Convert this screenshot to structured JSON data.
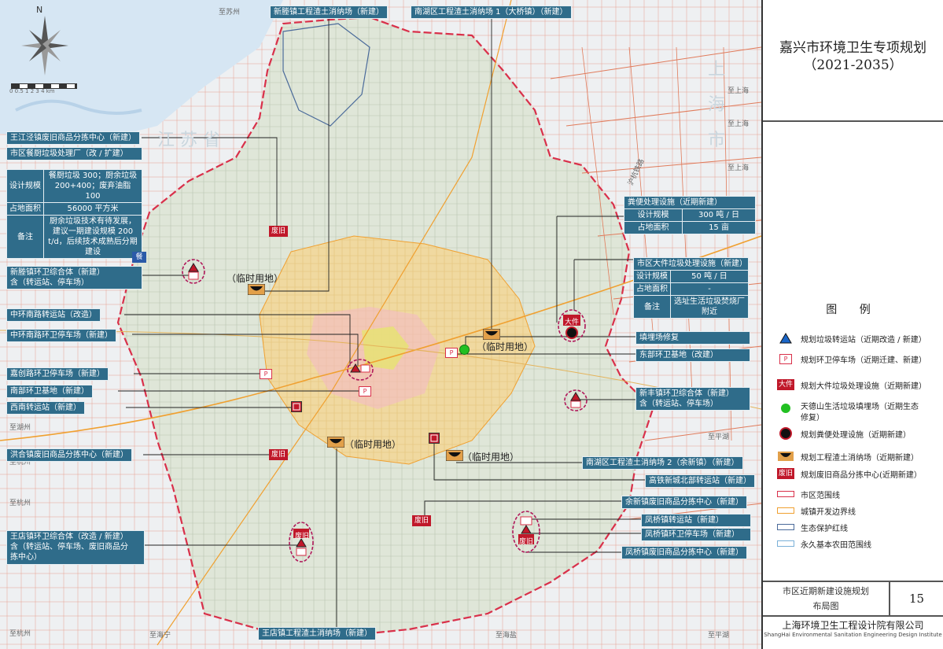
{
  "sheet": {
    "title_line1": "嘉兴市环境卫生专项规划",
    "title_line2": "（2021-2035）",
    "drawing_name_line1": "市区近期新建设施规划",
    "drawing_name_line2": "布局图",
    "sheet_number": "15",
    "institute_cn": "上海环境卫生工程设计院有限公司",
    "institute_en": "ShangHai Environmental Sanitation Engineering Design Institute"
  },
  "legend": {
    "title": "图 例",
    "items": [
      {
        "icon": "transfer-station-triangle",
        "label": "规划垃圾转运站（近期改造 / 新建）"
      },
      {
        "icon": "parking-p",
        "label": "规划环卫停车场（近期迁建、新建）"
      },
      {
        "icon": "bulky-waste-box",
        "icon_text": "大件",
        "label": "规划大件垃圾处理设施（近期新建）"
      },
      {
        "icon": "landfill-green-dot",
        "label": "天德山生活垃圾填埋场（近期生态",
        "label2": "修复）"
      },
      {
        "icon": "fecal-facility-dot",
        "label": "规划粪便处理设施（近期新建）"
      },
      {
        "icon": "construction-waste-bowl",
        "label": "规划工程渣土消纳场（近期新建）"
      },
      {
        "icon": "recycling-center-box",
        "icon_text": "废旧",
        "label": "规划废旧商品分拣中心(近期新建）"
      },
      {
        "icon": "city-boundary-line",
        "label": "市区范围线",
        "color": "#d9304a"
      },
      {
        "icon": "urban-boundary-line",
        "label": "城镇开发边界线",
        "color": "#f0a030"
      },
      {
        "icon": "ecological-redline",
        "label": "生态保护红线",
        "color": "#4a6a9a"
      },
      {
        "icon": "farmland-line",
        "label": "永久基本农田范围线",
        "color": "#7ab0d8"
      }
    ]
  },
  "map": {
    "scale_label": "0 0.5 1   2   3   4 km",
    "north_label": "N",
    "big_labels": [
      "江 苏 省",
      "上",
      "海",
      "市"
    ],
    "places": [
      "至苏州",
      "至上海",
      "至上海",
      "至上海",
      "至湖州",
      "至杭州",
      "至杭州",
      "至杭州",
      "至平湖",
      "至海盐",
      "至海宁",
      "至平湖",
      "沪杭铁路"
    ],
    "temp_land": "（临时用地）",
    "callouts": {
      "xinsheng_waste": "新塍镇工程渣土消纳场（新建）",
      "nanhu_waste1": "南湖区工程渣土消纳场 1（大桥镇）（新建）",
      "wangjiangjing_recycle": "王江泾镇废旧商品分拣中心（新建）",
      "kitchen_title": "市区餐厨垃圾处理厂（改 / 扩建）",
      "xinsheng_complex_1": "新塍镇环卫综合体（新建）",
      "xinsheng_complex_2": "含（转运站、停车场）",
      "zhonghuan_transfer": "中环南路转运站（改造）",
      "zhonghuan_parking": "中环南路环卫停车场（新建）",
      "jiachuang_parking": "嘉创路环卫停车场（新建）",
      "nanbu_base": "南部环卫基地（新建）",
      "xinan_transfer": "西南转运站（新建）",
      "honghe_recycle": "洪合镇废旧商品分拣中心（新建）",
      "wangdian_complex_1": "王店镇环卫综合体（改造 / 新建）",
      "wangdian_complex_2": "含（转运站、停车场、废旧商品分",
      "wangdian_complex_3": "拣中心）",
      "wangdian_waste": "王店镇工程渣土消纳场（新建）",
      "fecal_title": "粪便处理设施（近期新建）",
      "bulky_title": "市区大件垃圾处理设施（新建）",
      "landfill_repair": "填埋场修复",
      "dongbu_base": "东部环卫基地（改建）",
      "xinfeng_complex_1": "新丰镇环卫综合体（新建）",
      "xinfeng_complex_2": "含（转运站、停车场）",
      "nanhu_waste2": "南湖区工程渣土消纳场 2（余新镇）（新建）",
      "gaotie_transfer": "高铁新城北部转运站（新建）",
      "yuxin_recycle": "余新镇废旧商品分拣中心（新建）",
      "fengqiao_transfer": "凤桥镇转运站（新建）",
      "fengqiao_parking": "凤桥镇环卫停车场（新建）",
      "fengqiao_recycle": "凤桥镇废旧商品分拣中心（新建）"
    },
    "kitchen_table": {
      "row1_k": "设计规模",
      "row1_v": "餐厨垃圾 300；厨余垃圾 200+400；废弃油脂 100",
      "row2_k": "占地面积",
      "row2_v": "56000 平方米",
      "row3_k": "备注",
      "row3_v": "厨余垃圾技术有待发展，建议一期建设规模 200 t/d，后续技术成熟后分期建设"
    },
    "fecal_table": {
      "row1_k": "设计规模",
      "row1_v": "300 吨 / 日",
      "row2_k": "占地面积",
      "row2_v": "15 亩"
    },
    "bulky_table": {
      "row1_k": "设计规模",
      "row1_v": "50 吨 / 日",
      "row2_k": "占地面积",
      "row2_v": "-",
      "row3_k": "备注",
      "row3_v": "选址生活垃圾焚烧厂附近"
    },
    "icon_texts": {
      "bulky": "大件",
      "recycle": "废旧",
      "parking": "P",
      "kitchen": "餐"
    },
    "colors": {
      "label_bg": "#2f6c8a",
      "boundary": "#d9304a",
      "urban": "#f0a030",
      "farmland": "#7ab0d8",
      "redline": "#4a6a9a"
    }
  }
}
